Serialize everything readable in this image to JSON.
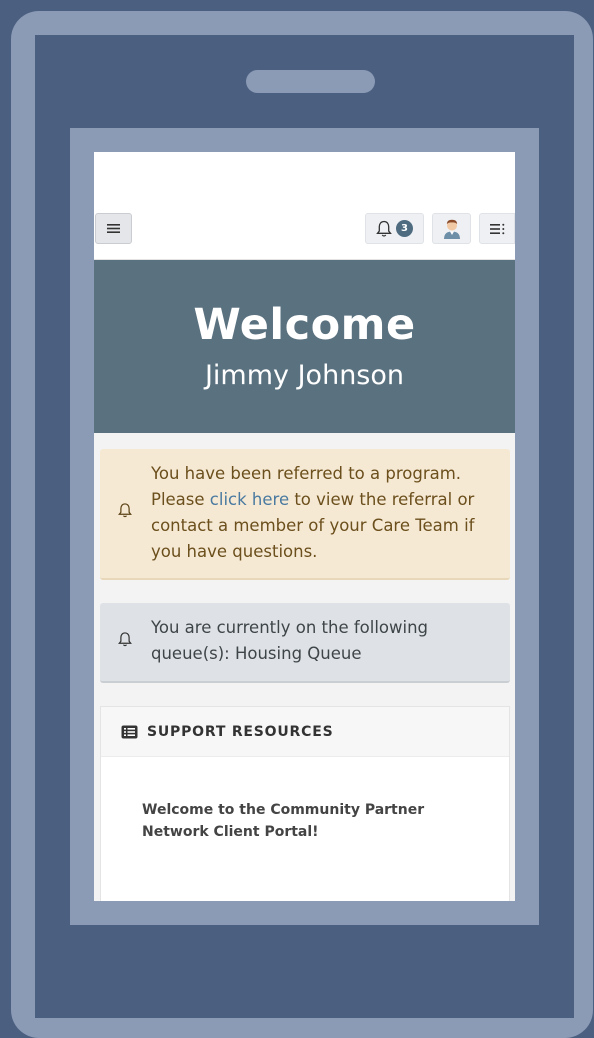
{
  "topbar": {
    "menu_icon": "hamburger-icon",
    "notification_count": "3",
    "notification_icon": "bell-icon",
    "avatar_icon": "user-avatar-icon",
    "list_icon": "list-menu-icon"
  },
  "hero": {
    "title": "Welcome",
    "name": "Jimmy Johnson"
  },
  "alerts": {
    "referral": {
      "text_before": "You have been referred to a program. Please ",
      "link": "click here",
      "text_after": " to view the referral or contact a member of your Care Team if you have questions."
    },
    "queue": {
      "text": "You are currently on the following queue(s): Housing Queue"
    }
  },
  "support": {
    "header": "SUPPORT RESOURCES",
    "body": "Welcome to the Community Partner Network Client Portal!"
  },
  "colors": {
    "background": "#4b5f80",
    "frame": "#8b9ab5",
    "hero": "#5a717f",
    "warning": "#f6e9d4",
    "info": "#dee2e6",
    "link": "#4a7aa0"
  }
}
